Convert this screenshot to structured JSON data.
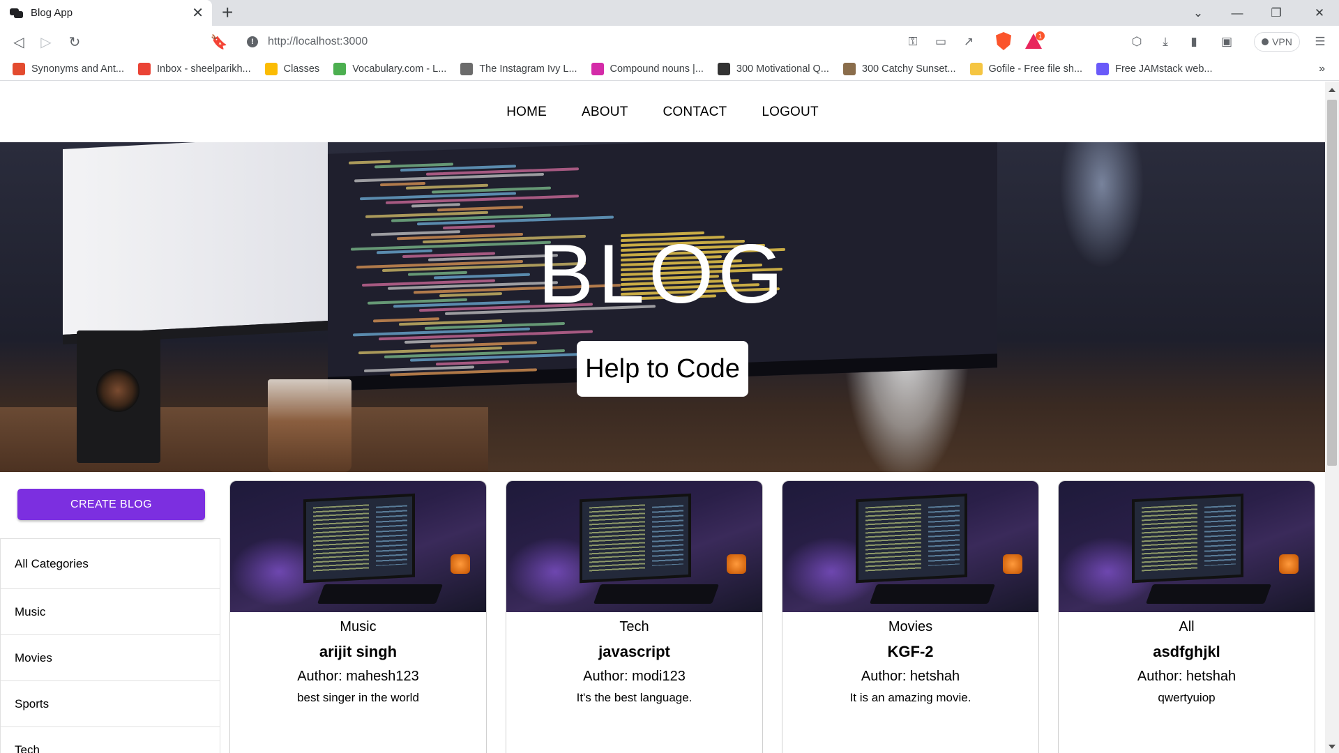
{
  "browser": {
    "tab_title": "Blog App",
    "url": "http://localhost:3000",
    "vpn_label": "VPN",
    "rewards_badge": "1",
    "bookmarks": [
      {
        "label": "Synonyms and Ant...",
        "icon": "thesaurus-icon",
        "color": "#e34b2f"
      },
      {
        "label": "Inbox - sheelparikh...",
        "icon": "gmail-icon",
        "color": "#ea4335"
      },
      {
        "label": "Classes",
        "icon": "classroom-icon",
        "color": "#fbbc04"
      },
      {
        "label": "Vocabulary.com - L...",
        "icon": "vocabulary-icon",
        "color": "#4caf50"
      },
      {
        "label": "The Instagram Ivy L...",
        "icon": "instagram-ivy-icon",
        "color": "#6b6b6b"
      },
      {
        "label": "Compound nouns |...",
        "icon": "ef-icon",
        "color": "#d42ba8"
      },
      {
        "label": "300 Motivational Q...",
        "icon": "globe-icon",
        "color": "#333333"
      },
      {
        "label": "300 Catchy Sunset...",
        "icon": "sunset-icon",
        "color": "#8a6d4b"
      },
      {
        "label": "Gofile - Free file sh...",
        "icon": "gofile-icon",
        "color": "#f5c542"
      },
      {
        "label": "Free JAMstack web...",
        "icon": "jamstack-icon",
        "color": "#6a5af9"
      }
    ]
  },
  "site": {
    "nav": [
      "HOME",
      "ABOUT",
      "CONTACT",
      "LOGOUT"
    ],
    "hero_title": "BLOG",
    "hero_subtitle": "Help to Code",
    "create_button": "CREATE BLOG",
    "categories": [
      "All Categories",
      "Music",
      "Movies",
      "Sports",
      "Tech"
    ],
    "posts": [
      {
        "category": "Music",
        "title": "arijit singh",
        "author": "Author: mahesh123",
        "description": "best singer in the world"
      },
      {
        "category": "Tech",
        "title": "javascript",
        "author": "Author: modi123",
        "description": "It's the best language."
      },
      {
        "category": "Movies",
        "title": "KGF-2",
        "author": "Author: hetshah",
        "description": "It is an amazing movie."
      },
      {
        "category": "All",
        "title": "asdfghjkl",
        "author": "Author: hetshah",
        "description": "qwertyuiop"
      }
    ]
  },
  "colors": {
    "accent": "#7c2fe0"
  }
}
